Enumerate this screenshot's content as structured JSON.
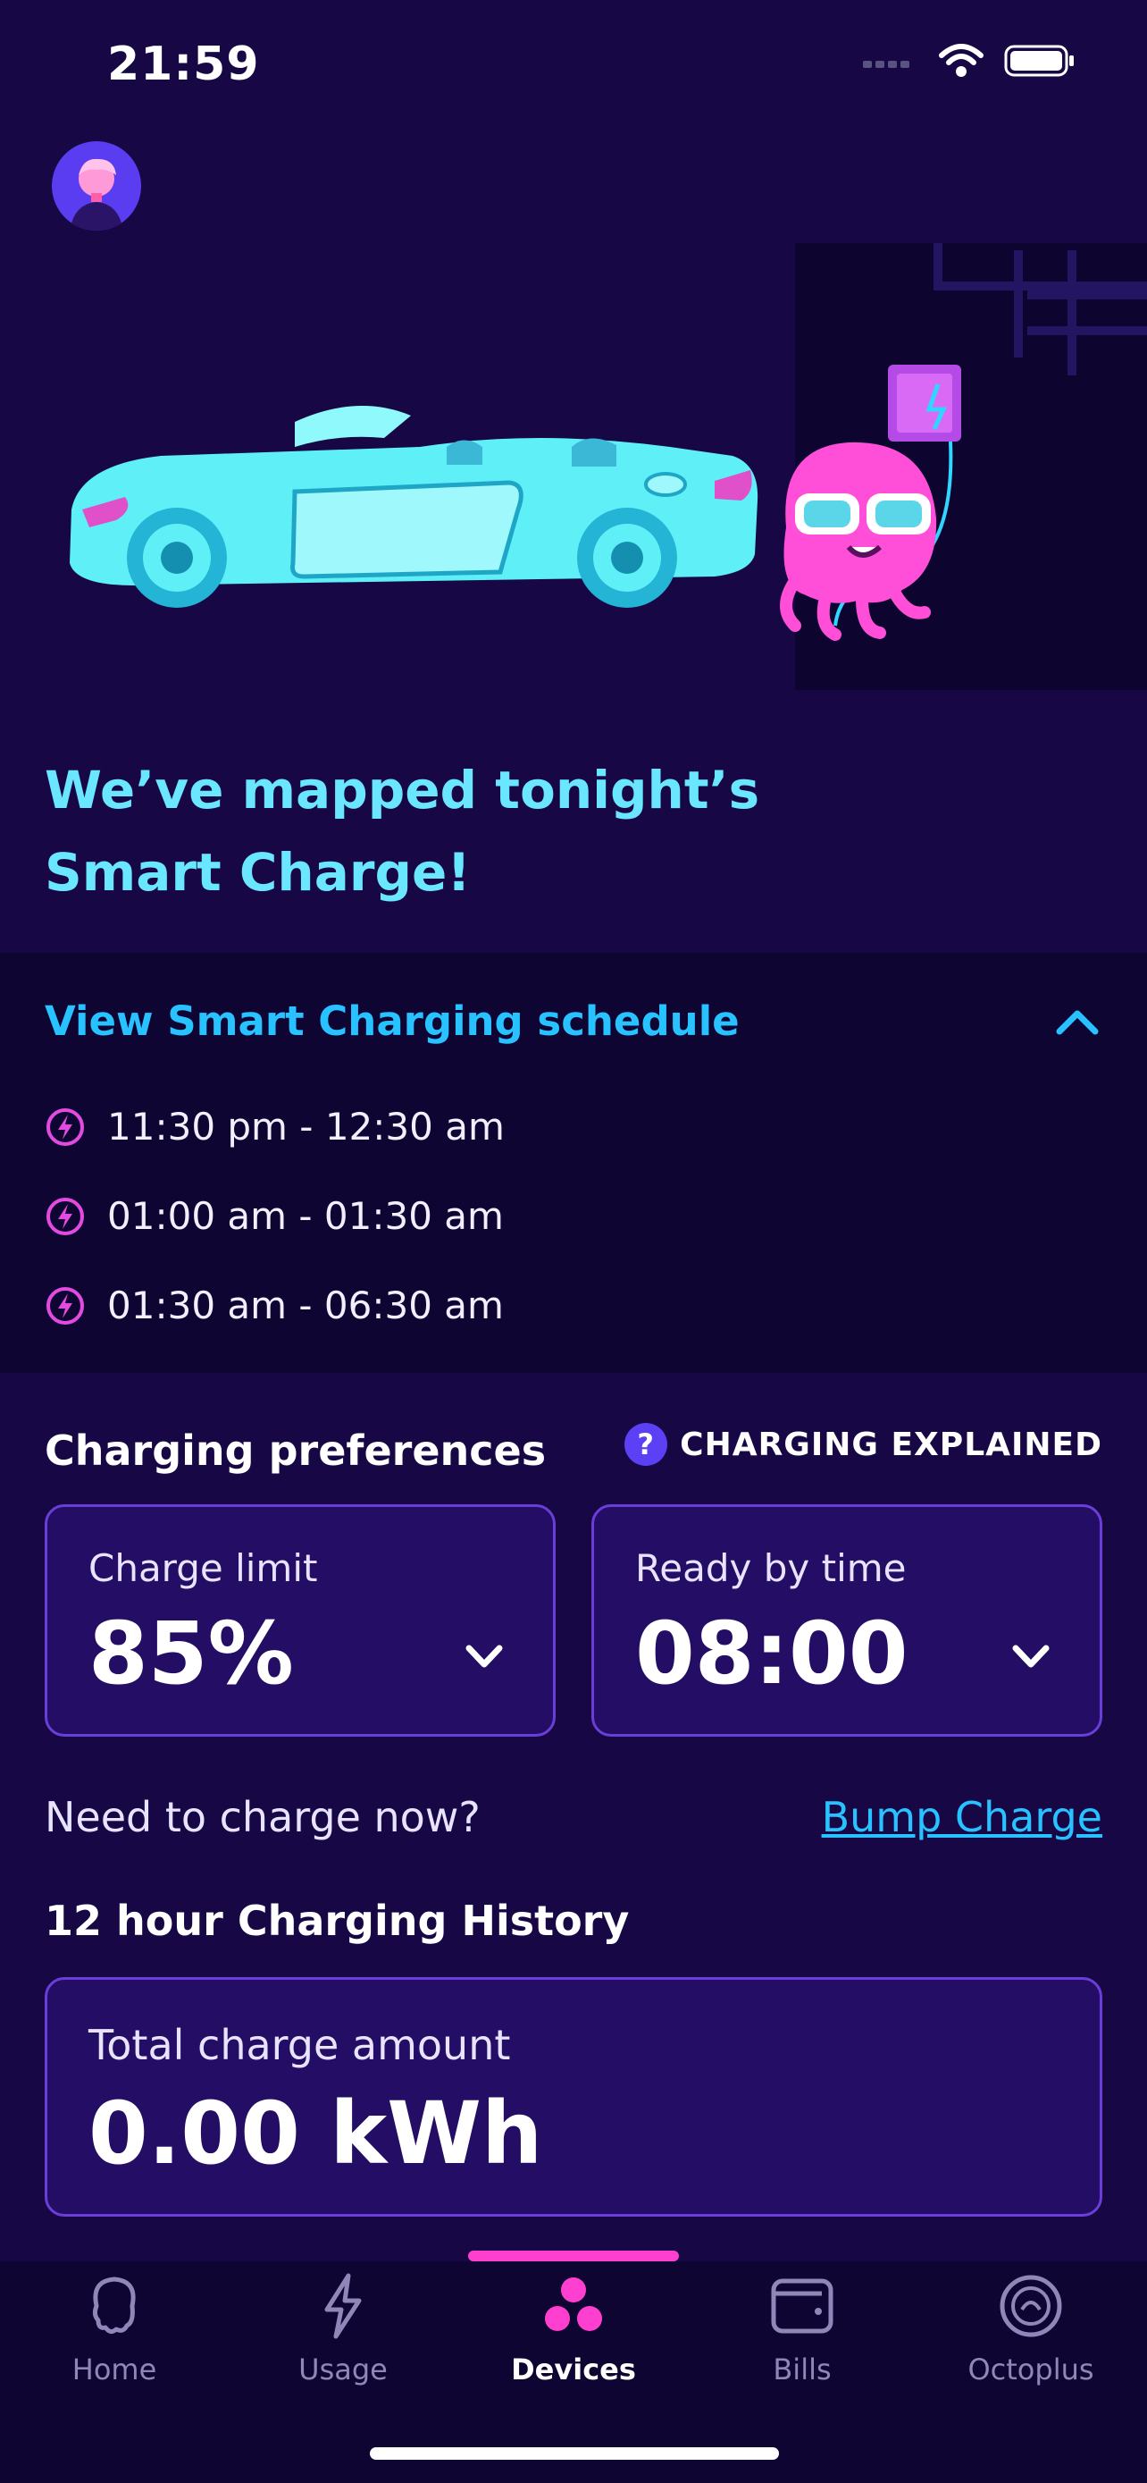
{
  "status": {
    "time": "21:59"
  },
  "hero": {
    "headline_line1": "We’ve mapped tonight’s",
    "headline_line2": "Smart Charge!"
  },
  "schedule": {
    "title": "View Smart Charging schedule",
    "slots": [
      "11:30 pm - 12:30 am",
      "01:00 am - 01:30 am",
      "01:30 am - 06:30 am"
    ]
  },
  "preferences": {
    "title": "Charging preferences",
    "explained": "CHARGING EXPLAINED",
    "explained_icon": "?",
    "charge_limit": {
      "label": "Charge limit",
      "value": "85%"
    },
    "ready_by": {
      "label": "Ready by time",
      "value": "08:00"
    }
  },
  "bump": {
    "question": "Need to charge now?",
    "link": "Bump Charge"
  },
  "history": {
    "title": "12 hour Charging History",
    "label": "Total charge amount",
    "value": "0.00 kWh"
  },
  "tabs": [
    {
      "label": "Home",
      "icon": "octopus-icon"
    },
    {
      "label": "Usage",
      "icon": "bolt-icon"
    },
    {
      "label": "Devices",
      "icon": "devices-icon"
    },
    {
      "label": "Bills",
      "icon": "wallet-icon"
    },
    {
      "label": "Octoplus",
      "icon": "octoplus-icon"
    }
  ],
  "colors": {
    "background": "#170845",
    "accent_cyan": "#27c2ff",
    "accent_pink": "#ff3fcf",
    "card": "#240d64"
  }
}
